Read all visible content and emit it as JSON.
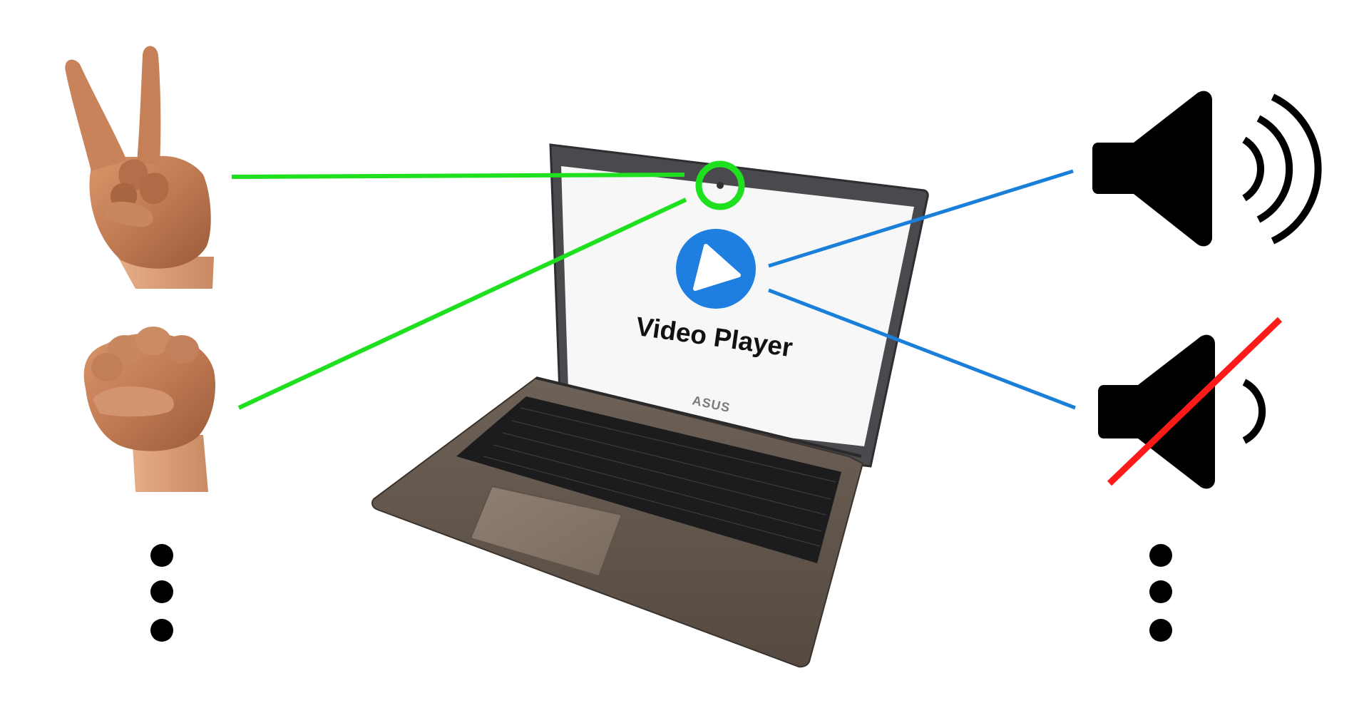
{
  "screen": {
    "label": "Video Player"
  },
  "laptop": {
    "brand": "ASUS"
  },
  "gestures": [
    {
      "name": "peace-sign",
      "meaning": "v-sign"
    },
    {
      "name": "fist",
      "meaning": "fist"
    }
  ],
  "actions": [
    {
      "name": "volume-up"
    },
    {
      "name": "mute"
    }
  ],
  "colors": {
    "gesture_link": "#1fe01f",
    "action_link": "#1a7fd9",
    "play_button": "#1e7fe0",
    "mute_slash": "#ff1a1a",
    "speaker": "#000000"
  }
}
